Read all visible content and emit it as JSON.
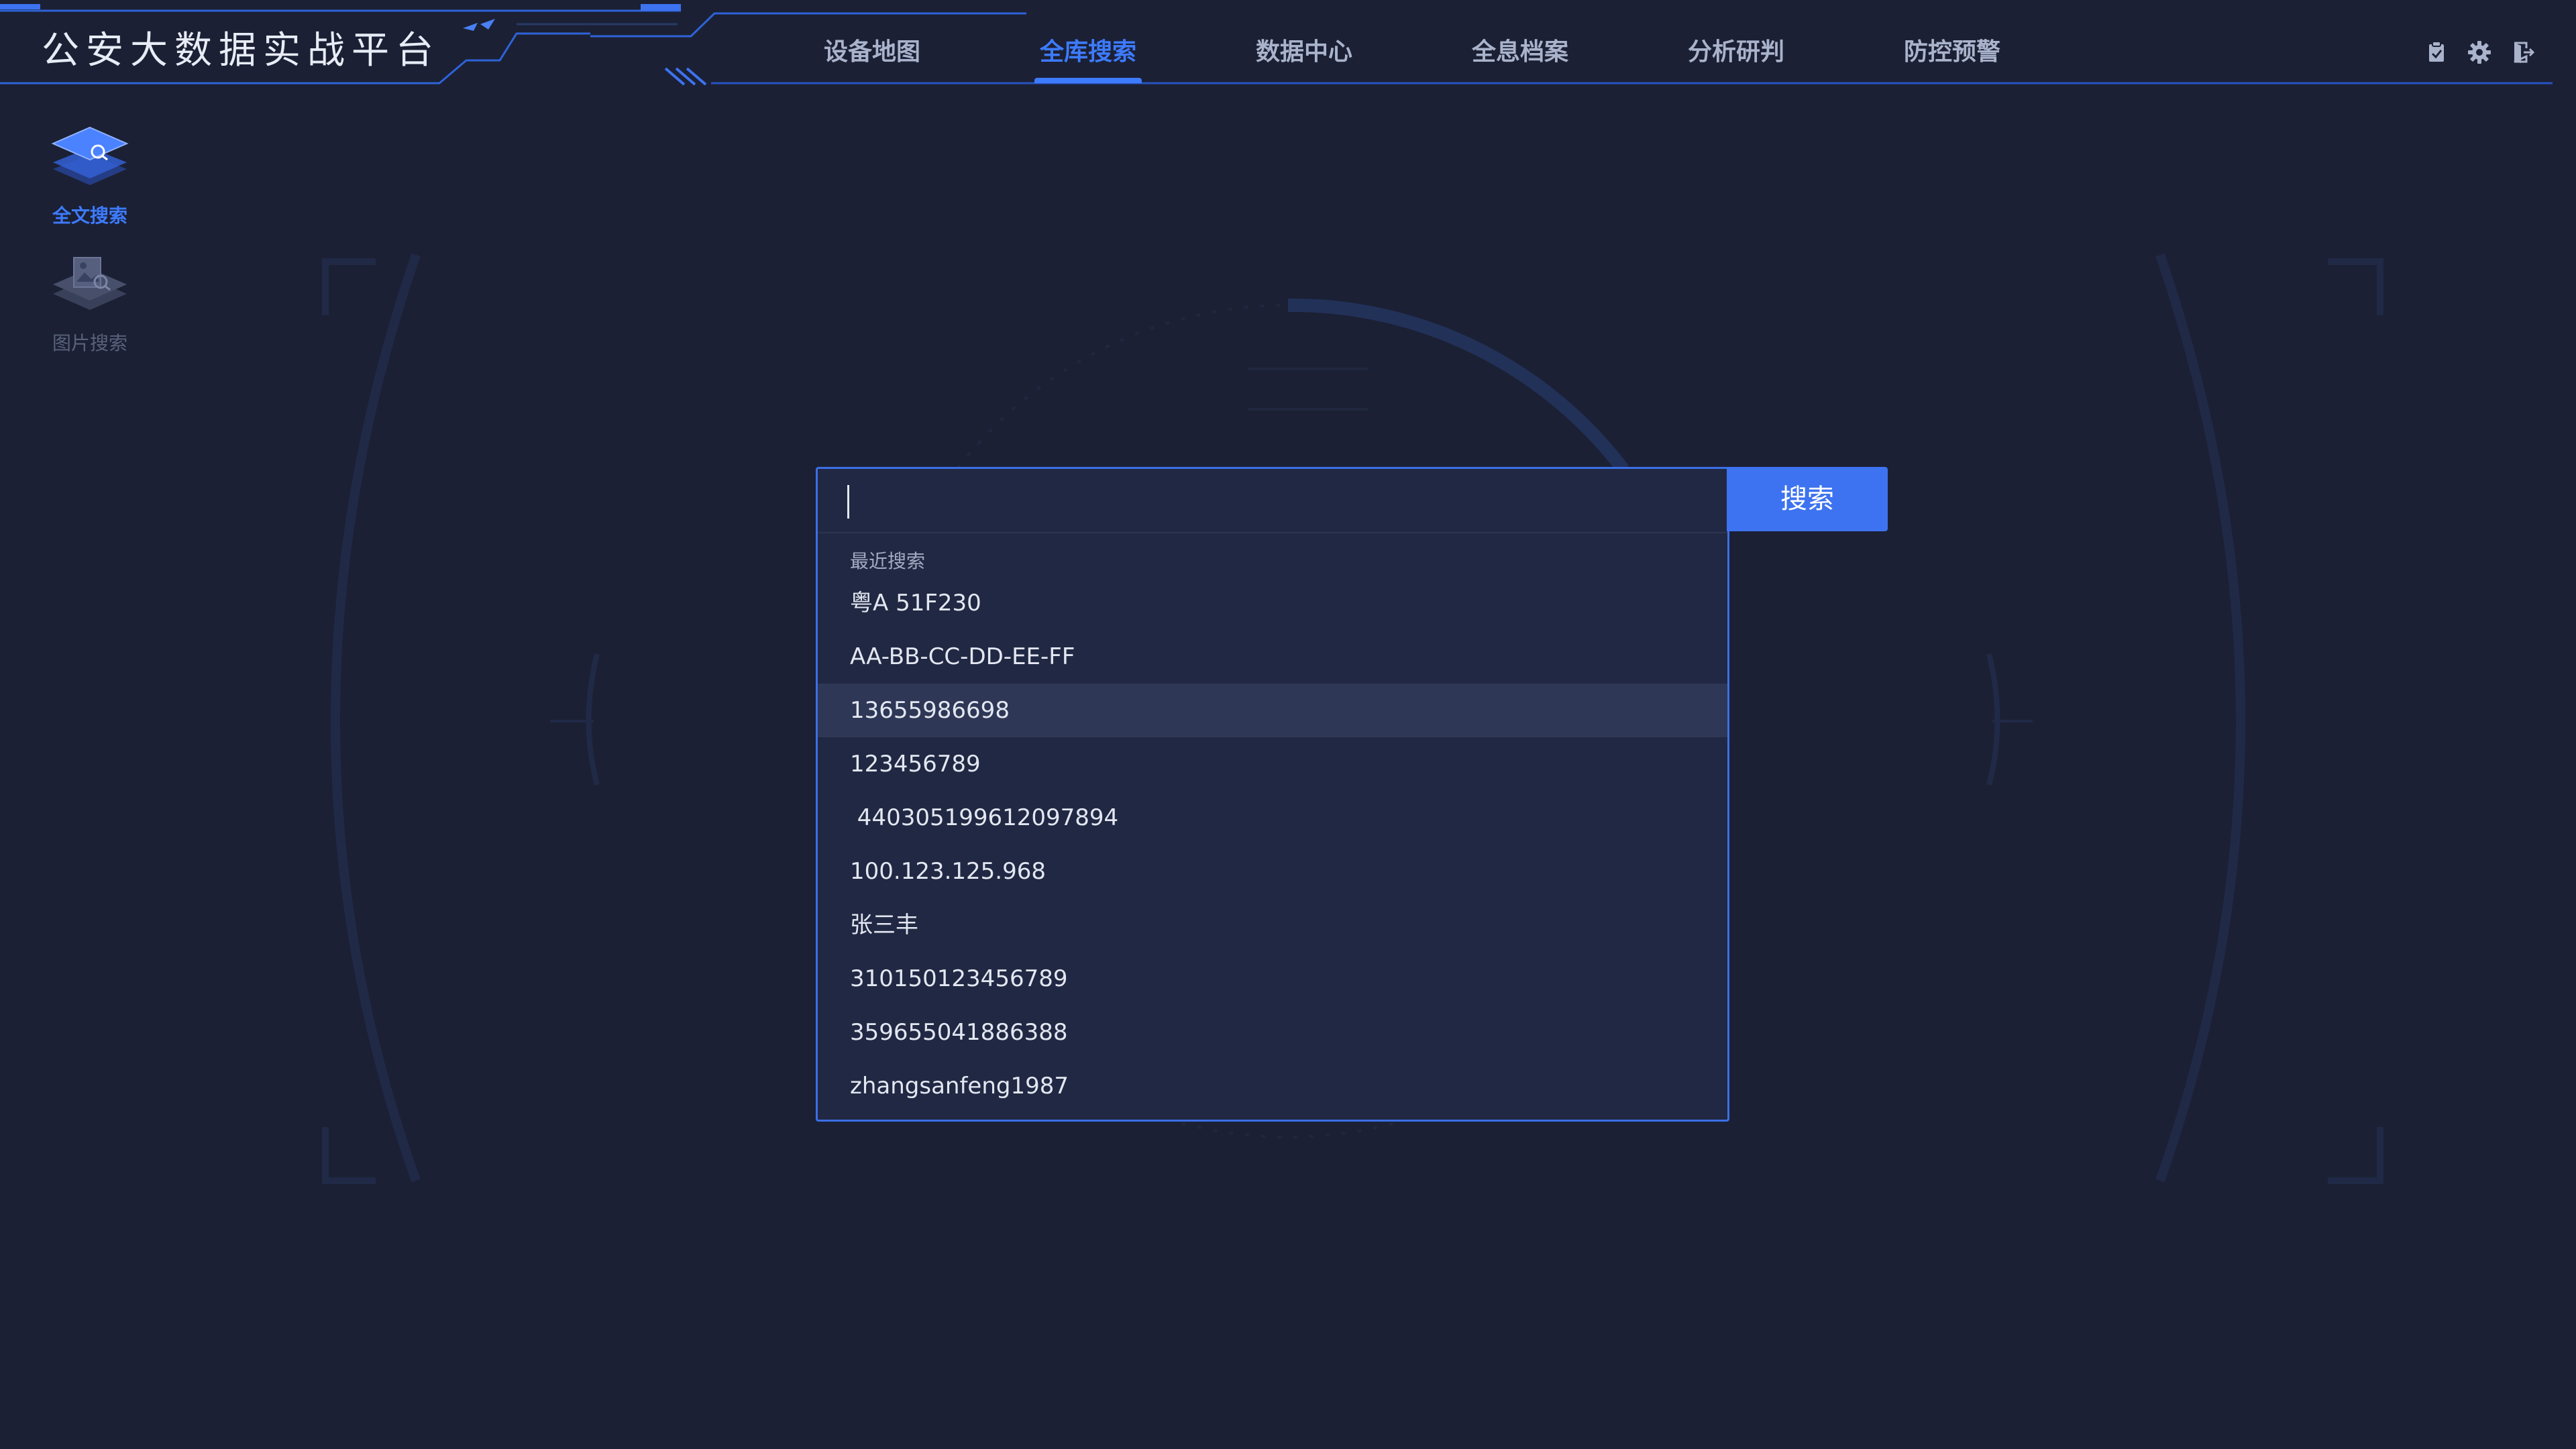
{
  "app": {
    "title": "公安大数据实战平台"
  },
  "nav": {
    "tabs": [
      {
        "label": "设备地图",
        "active": false
      },
      {
        "label": "全库搜索",
        "active": true
      },
      {
        "label": "数据中心",
        "active": false
      },
      {
        "label": "全息档案",
        "active": false
      },
      {
        "label": "分析研判",
        "active": false
      },
      {
        "label": "防控预警",
        "active": false
      }
    ]
  },
  "header_icons": [
    "clipboard-icon",
    "gear-icon",
    "logout-icon"
  ],
  "sidebar": {
    "items": [
      {
        "label": "全文搜索",
        "icon": "layers-search-icon",
        "active": true
      },
      {
        "label": "图片搜索",
        "icon": "image-search-icon",
        "active": false
      }
    ]
  },
  "search": {
    "value": "",
    "placeholder": "",
    "button_label": "搜索",
    "recent_header": "最近搜索",
    "recent": [
      "粤A 51F230",
      "AA-BB-CC-DD-EE-FF",
      "13655986698",
      "123456789",
      " 440305199612097894",
      "100.123.125.968",
      "张三丰",
      "310150123456789",
      "359655041886388",
      "zhangsanfeng1987"
    ],
    "highlighted_index": 2
  },
  "colors": {
    "background": "#1b2034",
    "accent": "#3d7bff",
    "panel": "#212843",
    "highlight_row": "#2e3756",
    "nav_text": "#a9b3cb",
    "muted": "#59627b"
  }
}
